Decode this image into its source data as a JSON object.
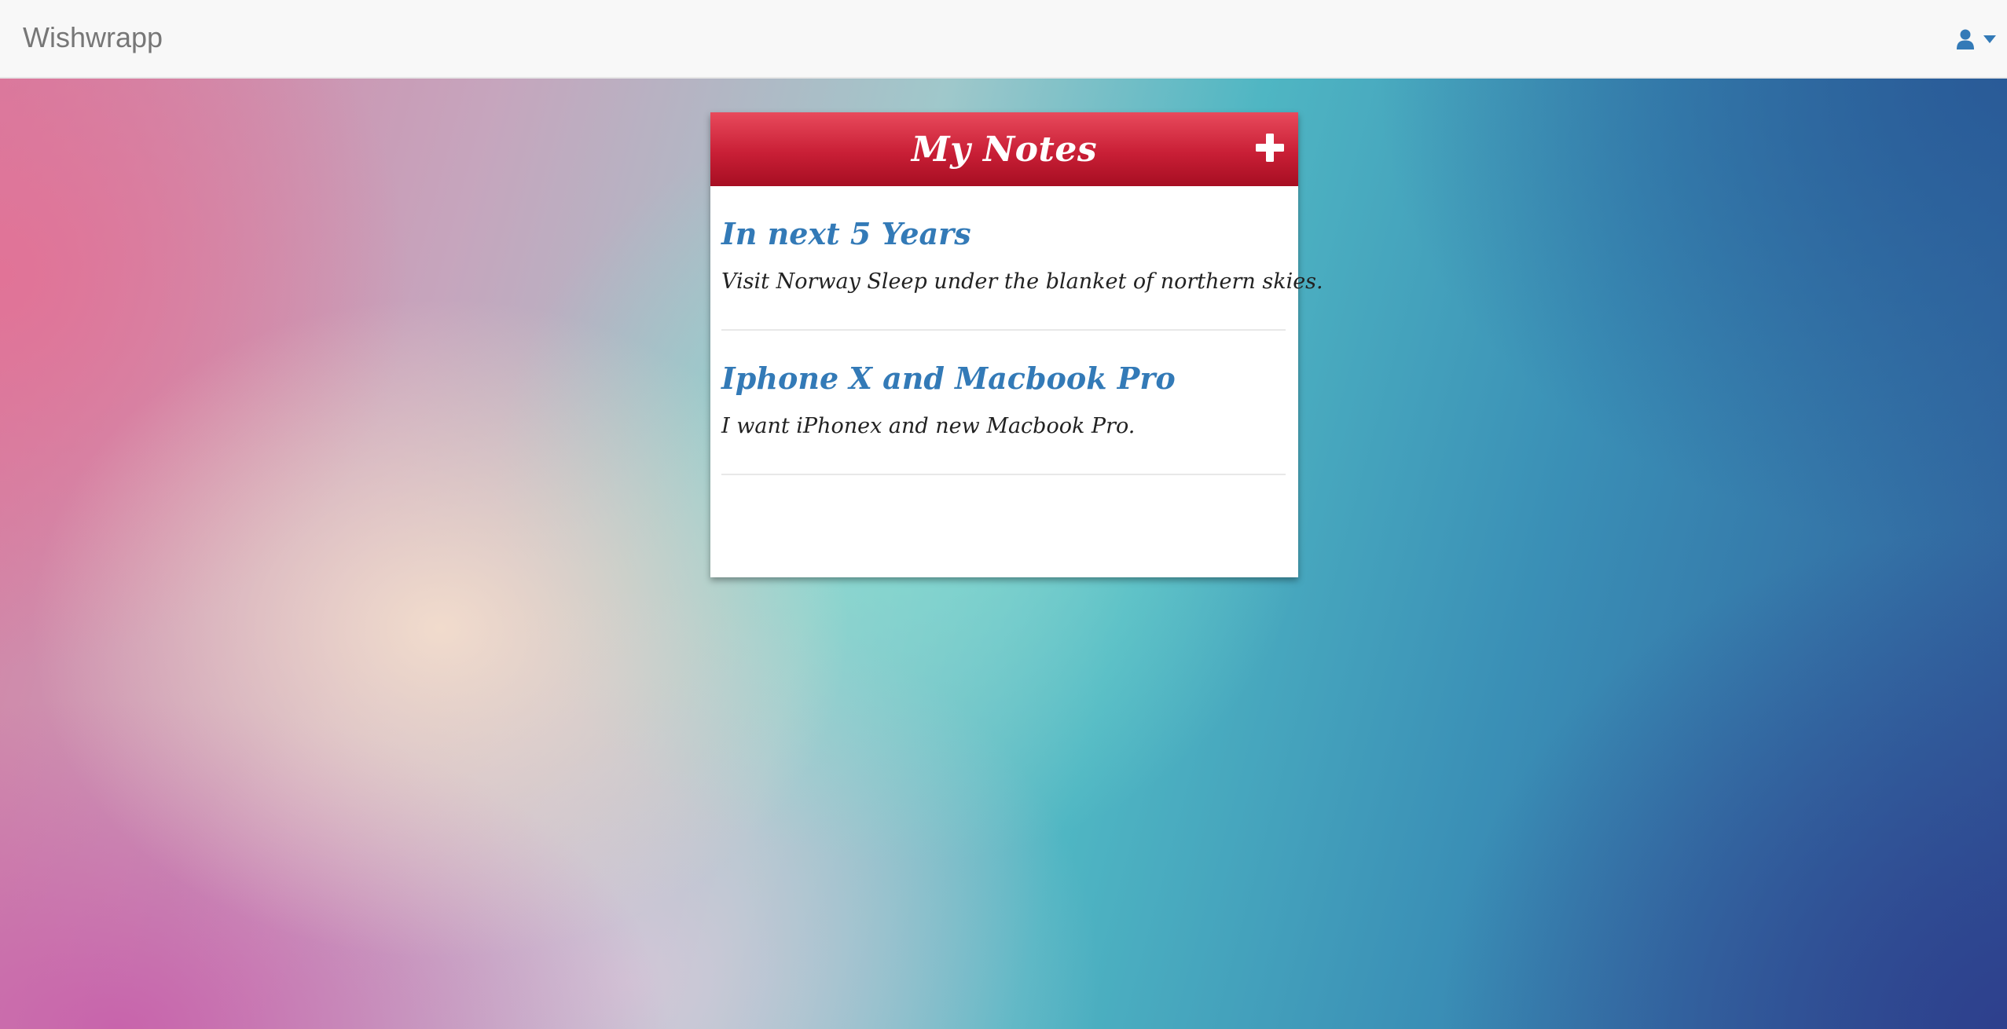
{
  "navbar": {
    "brand": "Wishwrapp",
    "user_menu_icon": "user-icon",
    "caret_icon": "caret-down-icon"
  },
  "notes_panel": {
    "title": "My Notes",
    "add_icon": "plus-icon",
    "notes": [
      {
        "title": "In next 5 Years",
        "text": "Visit Norway Sleep under the blanket of northern skies."
      },
      {
        "title": "Iphone X and Macbook Pro",
        "text": "I want iPhonex and new Macbook Pro."
      }
    ]
  },
  "colors": {
    "header_red": "#c91f36",
    "note_title_blue": "#337ab7",
    "brand_gray": "#777777",
    "user_icon_blue": "#337ab7"
  }
}
